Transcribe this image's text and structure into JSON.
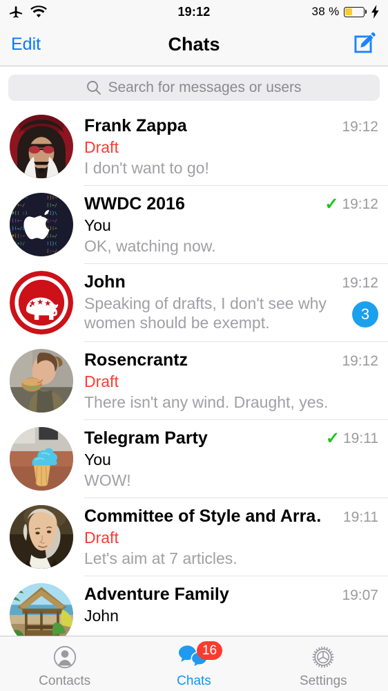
{
  "statusbar": {
    "icons": [
      "airplane-mode-icon",
      "wifi-icon"
    ],
    "time": "19:12",
    "battery_percent": "38 %",
    "battery_level": 38,
    "charging": true
  },
  "navbar": {
    "left_button": "Edit",
    "title": "Chats",
    "right_button_icon": "compose-icon"
  },
  "search": {
    "placeholder": "Search for messages or users",
    "icon": "search-icon",
    "value": ""
  },
  "colors": {
    "accent_blue": "#007aff",
    "tab_active_blue": "#1195f5",
    "draft_red": "#fa3c30",
    "badge_blue": "#1ba0ec",
    "tabbadge_red": "#fc3b2f",
    "check_green": "#19c519",
    "time_gray": "#9b9b9f",
    "preview_gray": "#a0a0a5",
    "battery_yellow": "#fecb2e"
  },
  "chats": [
    {
      "avatar": "frank-zappa",
      "title": "Frank Zappa",
      "sender": "Draft",
      "is_draft": true,
      "preview": "I don't want to go!",
      "time": "19:12",
      "read_check": false,
      "unread": null
    },
    {
      "avatar": "wwdc-apple",
      "title": "WWDC 2016",
      "sender": "You",
      "is_draft": false,
      "preview": "OK, watching now.",
      "time": "19:12",
      "read_check": true,
      "unread": null
    },
    {
      "avatar": "gop-elephant",
      "title": "John",
      "sender": "",
      "is_draft": false,
      "preview": "Speaking of drafts, I don't see why women should be exempt.",
      "time": "19:12",
      "read_check": false,
      "unread": "3"
    },
    {
      "avatar": "rosencrantz-photo",
      "title": "Rosencrantz",
      "sender": "Draft",
      "is_draft": true,
      "preview": "There isn't any wind. Draught, yes.",
      "time": "19:12",
      "read_check": false,
      "unread": null
    },
    {
      "avatar": "cupcake-photo",
      "title": "Telegram Party",
      "sender": "You",
      "is_draft": false,
      "preview": "WOW!",
      "time": "19:11",
      "read_check": true,
      "unread": null
    },
    {
      "avatar": "hamilton-portrait",
      "title": "Committee of Style and Arra…",
      "sender": "Draft",
      "is_draft": true,
      "preview": "Let's aim at 7 articles.",
      "time": "19:11",
      "read_check": false,
      "unread": null
    },
    {
      "avatar": "beach-hut-photo",
      "title": "Adventure Family",
      "sender": "John",
      "is_draft": false,
      "preview": "",
      "time": "19:07",
      "read_check": false,
      "unread": null
    }
  ],
  "tabbar": {
    "tabs": [
      {
        "label": "Contacts",
        "icon": "contacts-icon",
        "active": false,
        "badge": null
      },
      {
        "label": "Chats",
        "icon": "chats-bubbles-icon",
        "active": true,
        "badge": "16"
      },
      {
        "label": "Settings",
        "icon": "gear-icon",
        "active": false,
        "badge": null
      }
    ]
  }
}
